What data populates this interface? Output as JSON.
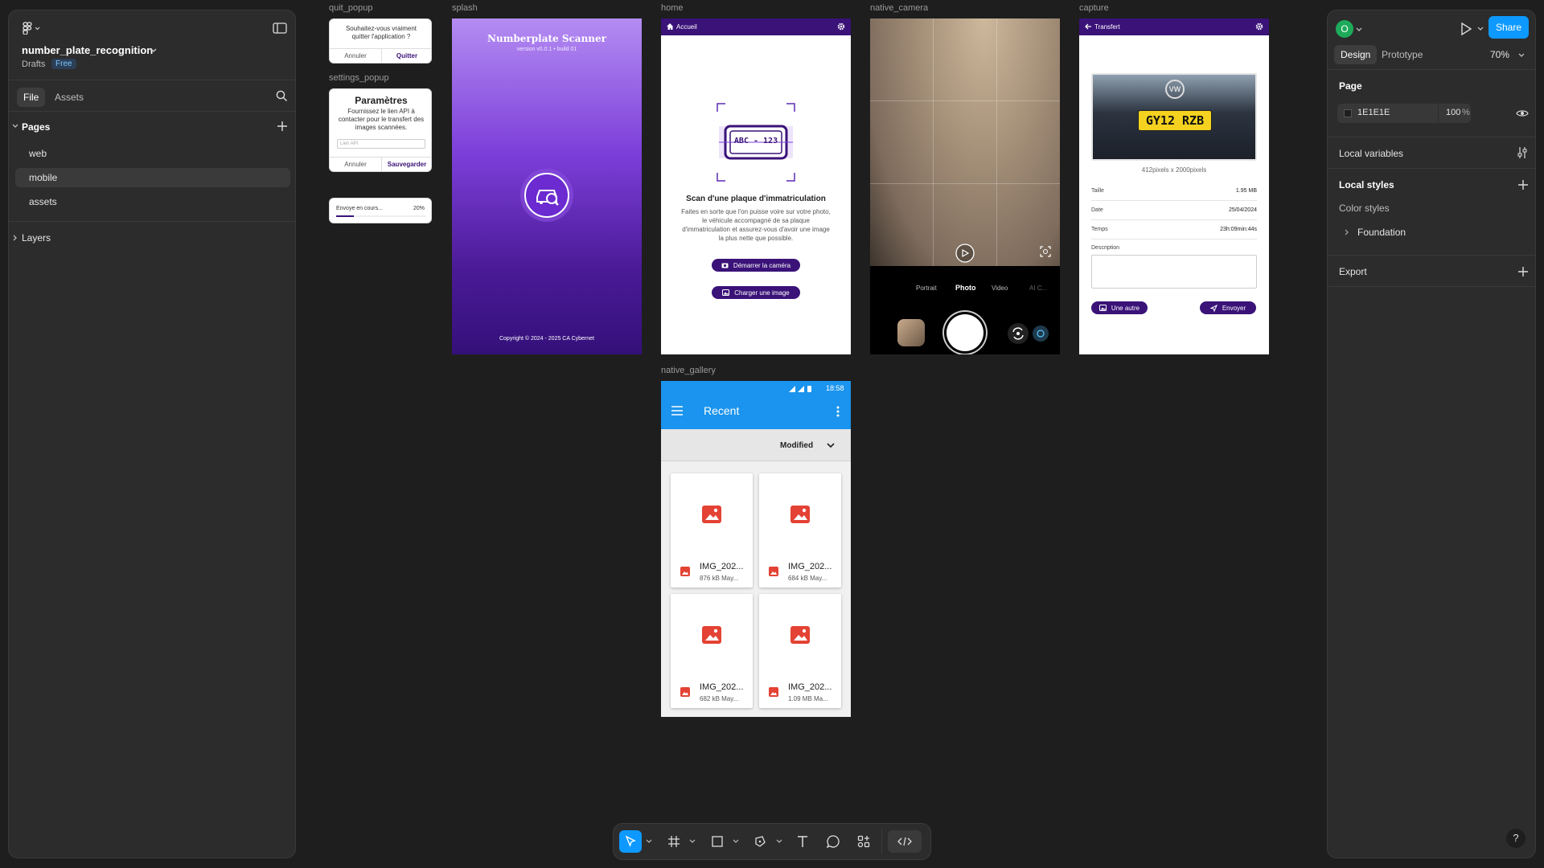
{
  "left_panel": {
    "file_name": "number_plate_recognition",
    "workspace": "Drafts",
    "plan_badge": "Free",
    "tabs": [
      "File",
      "Assets"
    ],
    "pages_label": "Pages",
    "pages": [
      "web",
      "mobile",
      "assets"
    ],
    "selected_page": "mobile",
    "layers_label": "Layers"
  },
  "right_panel": {
    "avatar_letter": "O",
    "share_label": "Share",
    "tabs": [
      "Design",
      "Prototype"
    ],
    "zoom": "70%",
    "page_label": "Page",
    "page_color": "1E1E1E",
    "page_opacity": "100",
    "percent": "%",
    "local_variables": "Local variables",
    "local_styles": "Local styles",
    "color_styles": "Color styles",
    "foundation": "Foundation",
    "export": "Export",
    "help": "?"
  },
  "frames": {
    "quit_popup": {
      "label": "quit_popup",
      "question": "Souhaitez-vous vraiment quitter l'application ?",
      "cancel": "Annuler",
      "quit": "Quitter"
    },
    "settings_popup": {
      "label": "settings_popup",
      "title": "Paramètres",
      "body": "Fournissez le lien API à contacter pour le transfert des images scannées.",
      "input_placeholder": "Lien API",
      "cancel": "Annuler",
      "save": "Sauvegarder"
    },
    "progress_popup": {
      "text": "Envoye en cours...",
      "percent": "20%",
      "progress": 0.2
    },
    "splash": {
      "label": "splash",
      "title": "Numberplate Scanner",
      "version": "version v0.0.1 • build 01",
      "copyright": "Copyright © 2024 - 2025 CA Cybernet"
    },
    "home": {
      "label": "home",
      "header": "Accueil",
      "plate": "ABC - 123",
      "title": "Scan d'une plaque d'immatriculation",
      "body": "Faites en sorte que l'on puisse voire sur votre photo, le véhicule accompagné de sa plaque d'immatriculation et assurez-vous d'avoir une image la plus nette que possible.",
      "btn_camera": "Démarrer la caméra",
      "btn_image": "Charger une image"
    },
    "native_camera": {
      "label": "native_camera",
      "modes": [
        "Portrait",
        "Photo",
        "Video",
        "AI C..."
      ],
      "selected_mode": "Photo"
    },
    "capture": {
      "label": "capture",
      "header": "Transfert",
      "plate_text": "GY12 RZB",
      "dimensions": "412pixels x 2000pixels",
      "rows": [
        {
          "key": "Taille",
          "value": "1.95 MB"
        },
        {
          "key": "Date",
          "value": "25/04/2024"
        },
        {
          "key": "Temps",
          "value": "23h:09min:44s"
        }
      ],
      "description_label": "Description",
      "btn_other": "Une autre",
      "btn_send": "Envoyer"
    },
    "native_gallery": {
      "label": "native_gallery",
      "time": "18:58",
      "title": "Recent",
      "sort": "Modified",
      "items": [
        {
          "name": "IMG_202...",
          "meta": "876 kB May..."
        },
        {
          "name": "IMG_202...",
          "meta": "684 kB May..."
        },
        {
          "name": "IMG_202...",
          "meta": "682 kB May..."
        },
        {
          "name": "IMG_202...",
          "meta": "1.09 MB Ma..."
        }
      ]
    }
  },
  "colors": {
    "accent": "#0d99ff",
    "purple_dark": "#3a1278",
    "gallery_blue": "#1a94ee",
    "image_red": "#e34234"
  }
}
